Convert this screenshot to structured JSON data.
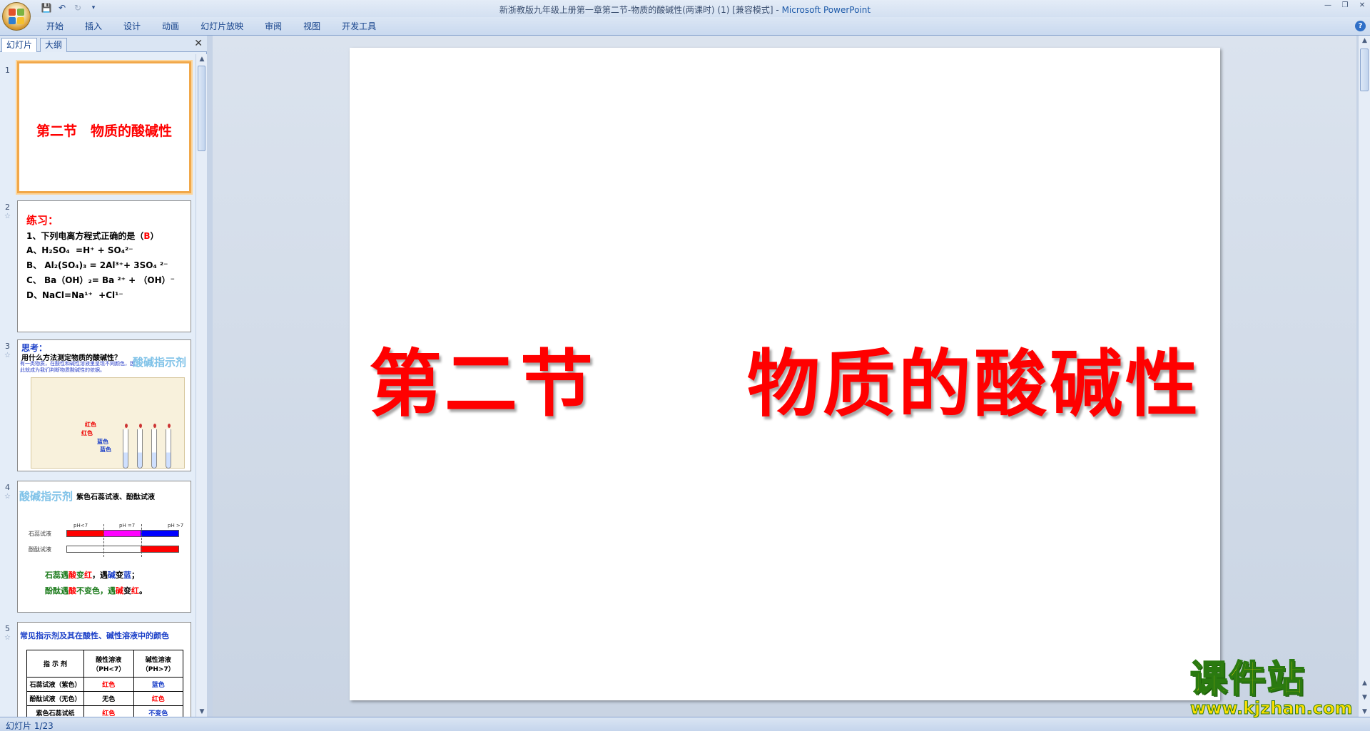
{
  "window": {
    "title": "新浙教版九年级上册第一章第二节-物质的酸碱性(两课时) (1) [兼容模式] - ",
    "app_name": "Microsoft PowerPoint"
  },
  "ribbon": {
    "tabs": [
      "开始",
      "插入",
      "设计",
      "动画",
      "幻灯片放映",
      "审阅",
      "视图",
      "开发工具"
    ]
  },
  "panel": {
    "tabs": [
      "幻灯片",
      "大纲"
    ],
    "close_symbol": "✕"
  },
  "thumbnails": {
    "s1": {
      "num": "1",
      "title": "第二节　物质的酸碱性"
    },
    "s2": {
      "num": "2",
      "heading": "练习：",
      "q": "1、下列电离方程式正确的是（",
      "ans": "B",
      "q_end": "）",
      "a": "A、H₂SO₄  =H⁺ + SO₄²⁻",
      "b": "B、 Al₂(SO₄)₃ = 2Al³⁺+ 3SO₄ ²⁻",
      "c": "C、 Ba（OH）₂= Ba ²⁺ + （OH）⁻",
      "d": "D、NaCl=Na¹⁺  +Cl¹⁻"
    },
    "s3": {
      "num": "3",
      "think": "思考：",
      "question": "用什么方法测定物质的酸碱性？",
      "note": "有一类物质，在酸性和碱性溶液里呈现不同颜色，因此就成为我们判断物质酸碱性的依据。",
      "tag": "酸碱指示剂",
      "red1": "红色",
      "red2": "红色",
      "blue1": "蓝色",
      "blue2": "蓝色"
    },
    "s4": {
      "num": "4",
      "tag": "酸碱指示剂",
      "sub": "紫色石蕊试液、酚酞试液",
      "row1": "石蕊试液",
      "row2": "酚酞试液",
      "ph1": "pH<7",
      "ph2": "pH =7",
      "ph3": "pH >7",
      "line1_a": "石蕊遇",
      "line1_b": "酸",
      "line1_c": "变",
      "line1_d": "红",
      "line1_e": "，遇",
      "line1_f": "碱",
      "line1_g": "变",
      "line1_h": "蓝",
      "line1_i": "；",
      "line2_a": "酚酞遇",
      "line2_b": "酸",
      "line2_c": "不变色，遇",
      "line2_d": "碱",
      "line2_e": "变",
      "line2_f": "红",
      "line2_g": "。"
    },
    "s5": {
      "num": "5",
      "heading": "常见指示剂及其在酸性、碱性溶液中的颜色",
      "col1": "指 示 剂",
      "col2": "酸性溶液（PH<7）",
      "col3": "碱性溶液（PH>7）",
      "r1": [
        "石蕊试液（紫色）",
        "红色",
        "蓝色"
      ],
      "r2": [
        "酚酞试液（无色）",
        "无色",
        "红色"
      ],
      "r3": [
        "紫色石蕊试纸",
        "红色",
        "不变色"
      ]
    }
  },
  "slide": {
    "title": "第二节　　物质的酸碱性"
  },
  "statusbar": {
    "text": "幻灯片 1/23"
  },
  "watermark": {
    "cn": "课件站",
    "url": "www.kjzhan.com"
  },
  "colors": {
    "accent_red": "#ff0000",
    "selection_orange": "#f1a84a",
    "ribbon_blue": "#15428b"
  }
}
